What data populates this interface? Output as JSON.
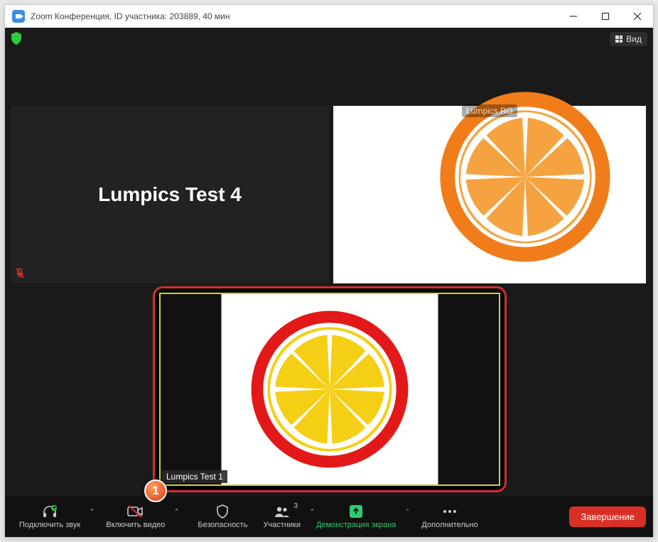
{
  "window": {
    "title": "Zoom Конференция, ID участника: 203889, 40 мин"
  },
  "topbar": {
    "view_label": "Вид"
  },
  "tiles": {
    "t1": {
      "name": "Lumpics Test 4"
    },
    "t2": {
      "name": "Lumpics RG"
    },
    "spotlight": {
      "name": "Lumpics Test 1"
    }
  },
  "annotation": {
    "badge1": "1"
  },
  "bottombar": {
    "connect_audio": "Подключить звук",
    "start_video": "Включить видео",
    "security": "Безопасность",
    "participants": "Участники",
    "participants_count": "3",
    "share_screen": "Демонстрация экрана",
    "more": "Дополнительно",
    "end": "Завершение"
  },
  "colors": {
    "orange_outer": "#f07d1a",
    "orange_inner": "#f5a340",
    "lemon_outer": "#e31818",
    "lemon_inner": "#f5cf15"
  }
}
